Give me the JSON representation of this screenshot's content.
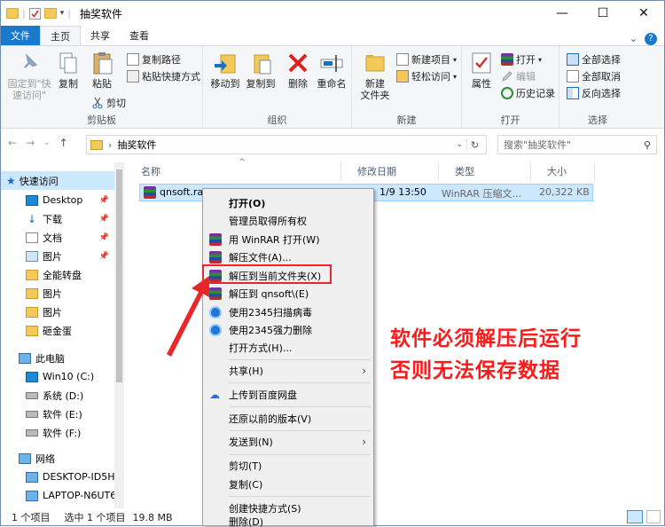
{
  "window": {
    "title": "抽奖软件",
    "controls": {
      "minimize": "—",
      "maximize": "☐",
      "close": "✕"
    }
  },
  "tabs": [
    {
      "label": "文件"
    },
    {
      "label": "主页"
    },
    {
      "label": "共享"
    },
    {
      "label": "查看"
    }
  ],
  "ribbon": {
    "clipboard": {
      "label": "剪贴板",
      "pin_quick_line1": "固定到\"快",
      "pin_quick_line2": "速访问\"",
      "copy": "复制",
      "paste": "粘贴",
      "copy_path": "复制路径",
      "paste_shortcut": "粘贴快捷方式",
      "cut": "剪切"
    },
    "organize": {
      "label": "组织",
      "move_to": "移动到",
      "copy_to": "复制到",
      "delete": "删除",
      "rename": "重命名"
    },
    "new": {
      "label": "新建",
      "new_folder_line1": "新建",
      "new_folder_line2": "文件夹",
      "new_item": "新建项目",
      "easy_access": "轻松访问"
    },
    "open": {
      "label": "打开",
      "properties": "属性",
      "open": "打开",
      "edit": "编辑",
      "history": "历史记录"
    },
    "select": {
      "label": "选择",
      "select_all": "全部选择",
      "select_none": "全部取消",
      "invert": "反向选择"
    }
  },
  "address": {
    "path": "抽奖软件",
    "search_placeholder": "搜索\"抽奖软件\""
  },
  "nav_pane": [
    {
      "label": "快速访问"
    },
    {
      "label": "Desktop"
    },
    {
      "label": "下载"
    },
    {
      "label": "文档"
    },
    {
      "label": "图片"
    },
    {
      "label": "全能转盘"
    },
    {
      "label": "图片"
    },
    {
      "label": "图片"
    },
    {
      "label": "砸金蛋"
    },
    {
      "label": "此电脑"
    },
    {
      "label": "Win10 (C:)"
    },
    {
      "label": "系统 (D:)"
    },
    {
      "label": "软件 (E:)"
    },
    {
      "label": "软件 (F:)"
    },
    {
      "label": "网络"
    },
    {
      "label": "DESKTOP-ID5H"
    },
    {
      "label": "LAPTOP-N6UT6"
    }
  ],
  "file_list": {
    "columns": [
      "名称",
      "修改日期",
      "类型",
      "大小"
    ],
    "rows": [
      {
        "name": "qnsoft.rar",
        "date": "1/9 13:50",
        "type": "WinRAR 压缩文...",
        "size": "20,322 KB"
      }
    ]
  },
  "status": {
    "count": "1 个项目",
    "selected": "选中 1 个项目",
    "size": "19.8 MB"
  },
  "context_menu": [
    {
      "label": "打开(O)",
      "bold": true
    },
    {
      "label": "管理员取得所有权"
    },
    {
      "label": "用 WinRAR 打开(W)"
    },
    {
      "label": "解压文件(A)..."
    },
    {
      "label": "解压到当前文件夹(X)"
    },
    {
      "label": "解压到 qnsoft\\(E)"
    },
    {
      "label": "使用2345扫描病毒"
    },
    {
      "label": "使用2345强力删除"
    },
    {
      "label": "打开方式(H)..."
    },
    {
      "label": "共享(H)"
    },
    {
      "label": "上传到百度网盘"
    },
    {
      "label": "还原以前的版本(V)"
    },
    {
      "label": "发送到(N)"
    },
    {
      "label": "剪切(T)"
    },
    {
      "label": "复制(C)"
    },
    {
      "label": "创建快捷方式(S)"
    },
    {
      "label": "删除(D)"
    }
  ],
  "annotation": {
    "line1": "软件必须解压后运行",
    "line2": "否则无法保存数据"
  }
}
